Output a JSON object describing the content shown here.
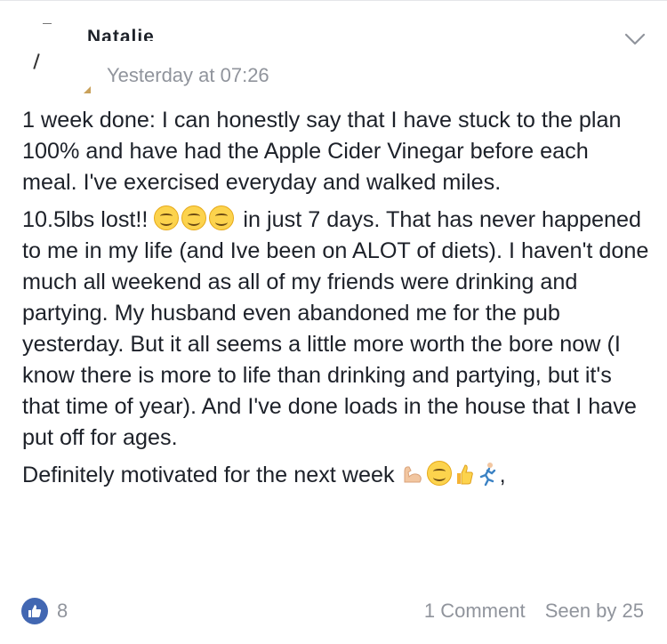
{
  "post": {
    "author": "Natalie",
    "timestamp": "Yesterday at 07:26",
    "paragraphs": {
      "p1": "1 week done: I can honestly say that I have stuck to the plan 100% and have had the Apple Cider Vinegar before each meal. I've exercised everyday and walked miles.",
      "p2_lead": "10.5lbs lost!!",
      "p2_rest": "in just 7 days. That has never happened to me in my life (and Ive been on ALOT of diets). I haven't done much all weekend as all of my friends were drinking and partying. My husband even abandoned me for the pub yesterday. But it all seems a little more worth the bore now (I know there is more to life than drinking and partying, but it's that time of year). And I've done loads in the house that I have put off for ages.",
      "p3": "Definitely motivated for the next week",
      "p3_tail": ","
    }
  },
  "footer": {
    "like_count": "8",
    "comments": "1 Comment",
    "seen_by": "Seen by 25"
  },
  "colors": {
    "like_blue": "#4267b2",
    "meta_gray": "#90949c",
    "text": "#1d2129"
  },
  "icons": [
    "chevron-down-icon",
    "smile-emoji-icon",
    "flexed-biceps-icon",
    "thumbs-up-icon",
    "runner-icon",
    "like-thumb-icon"
  ]
}
